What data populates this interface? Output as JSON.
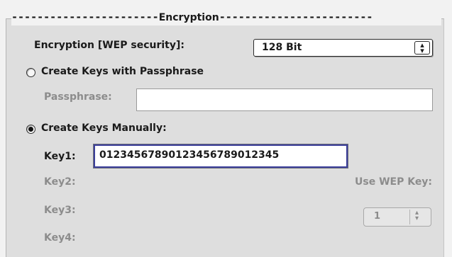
{
  "section": {
    "title": "Encryption",
    "dashes_left": "-----------------------",
    "dashes_right": "------------------------"
  },
  "encryption": {
    "label": "Encryption [WEP security]:",
    "value": "128 Bit"
  },
  "passphrase_option": {
    "label": "Create Keys with Passphrase",
    "selected": false,
    "field_label": "Passphrase:",
    "field_value": ""
  },
  "manual_option": {
    "label": "Create Keys Manually:",
    "selected": true
  },
  "keys": {
    "key1_label": "Key1:",
    "key1_value": "01234567890123456789012345",
    "key2_label": "Key2:",
    "key3_label": "Key3:",
    "key4_label": "Key4:"
  },
  "use_wep_key": {
    "label": "Use WEP Key:",
    "value": "1"
  },
  "colors": {
    "active_field_border": "#3c3f9a",
    "disabled_text": "#8c8c8c",
    "panel_bg": "#dedede"
  }
}
